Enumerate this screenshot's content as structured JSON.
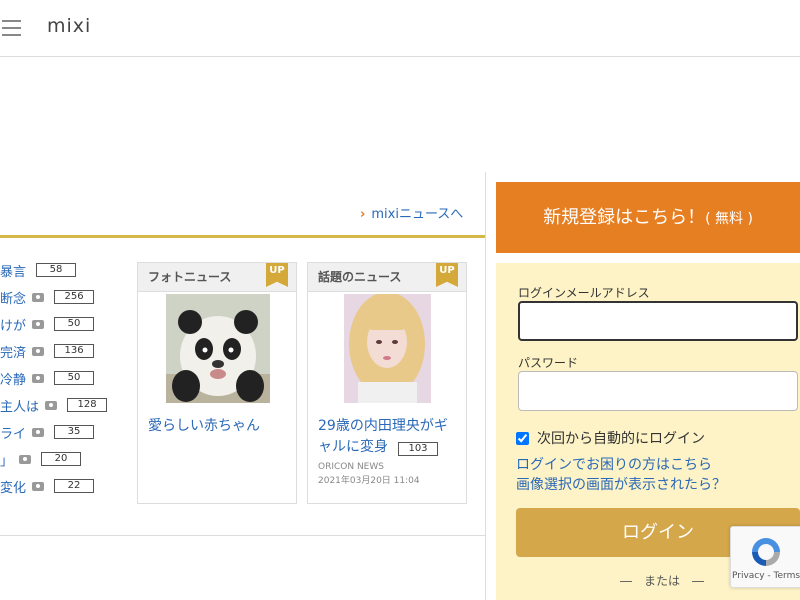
{
  "header": {
    "logo": "mixi"
  },
  "news_link": "mixiニュースへ",
  "ranking": [
    {
      "text": "暴言",
      "camera": false,
      "count": "58"
    },
    {
      "text": "断念",
      "camera": true,
      "count": "256"
    },
    {
      "text": "けが",
      "camera": true,
      "count": "50"
    },
    {
      "text": "完済",
      "camera": true,
      "count": "136"
    },
    {
      "text": "冷静",
      "camera": true,
      "count": "50"
    },
    {
      "text": "主人は",
      "camera": true,
      "count": "128"
    },
    {
      "text": "ライ",
      "camera": true,
      "count": "35"
    },
    {
      "text": "」",
      "camera": true,
      "count": "20"
    },
    {
      "text": "変化",
      "camera": true,
      "count": "22"
    }
  ],
  "cards": [
    {
      "heading": "フォトニュース",
      "badge": "UP",
      "title": "愛らしい赤ちゃん"
    },
    {
      "heading": "話題のニュース",
      "badge": "UP",
      "title_line1": "29歳の内田理央がギ",
      "title_line2": "ャルに変身",
      "count": "103",
      "source": "ORICON NEWS",
      "date": "2021年03月20日 11:04"
    }
  ],
  "signup": {
    "label": "新規登録はこちら！",
    "small": "( 無料 )"
  },
  "login": {
    "email_label": "ログインメールアドレス",
    "email_value": "",
    "password_label": "パスワード",
    "password_value": "",
    "remember_label": "次回から自動的にログイン",
    "remember_checked": true,
    "help_link": "ログインでお困りの方はこちら",
    "image_help_link": "画像選択の画面が表示されたら？",
    "button": "ログイン",
    "or_text": "―　または　―"
  },
  "recaptcha": {
    "terms": "Privacy - Terms"
  },
  "colors": {
    "accent_orange": "#e67e22",
    "login_gold": "#d4a74a",
    "link_blue": "#2a69b8",
    "panel_cream": "#fdf3c6"
  }
}
